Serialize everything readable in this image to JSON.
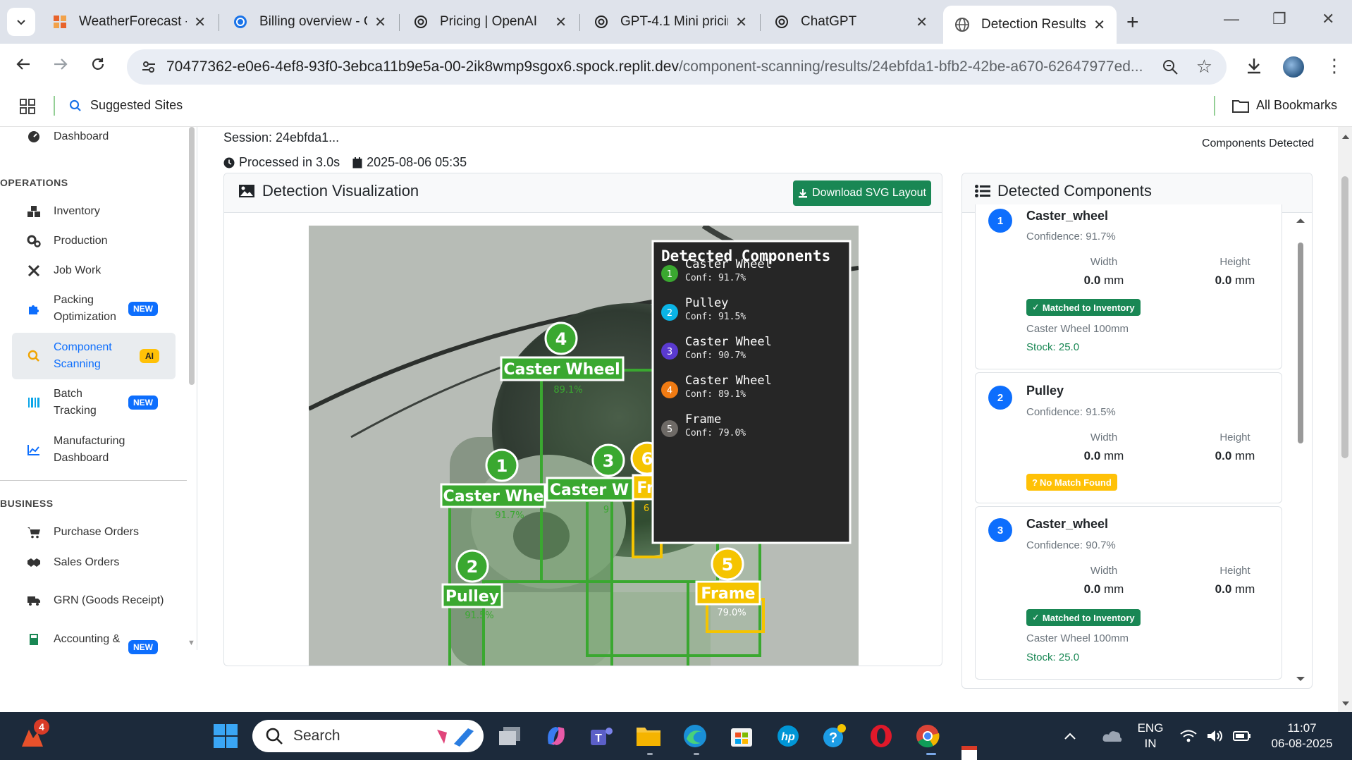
{
  "browser": {
    "tabs": [
      {
        "title": "WeatherForecast -",
        "icon": "weather-app-icon"
      },
      {
        "title": "Billing overview - C",
        "icon": "billing-icon"
      },
      {
        "title": "Pricing | OpenAI",
        "icon": "openai-icon"
      },
      {
        "title": "GPT-4.1 Mini pricir",
        "icon": "openai-icon"
      },
      {
        "title": "ChatGPT",
        "icon": "openai-icon"
      },
      {
        "title": "Detection Results -",
        "icon": "globe-icon",
        "active": true
      }
    ],
    "url_host": "70477362-e0e6-4ef8-93f0-3ebca11b9e5a-00-2ik8wmp9sgox6.spock.replit.dev",
    "url_path": "/component-scanning/results/24ebfda1-bfb2-42be-a670-62647977ed...",
    "bookmarks": {
      "suggested": "Suggested Sites",
      "all": "All Bookmarks"
    }
  },
  "sidebar": {
    "dashboard": "Dashboard",
    "sections": {
      "operations": "OPERATIONS",
      "business": "BUSINESS"
    },
    "items": [
      {
        "label": "Inventory"
      },
      {
        "label": "Production"
      },
      {
        "label": "Job Work"
      },
      {
        "label": "Packing Optimization",
        "badge": "NEW"
      },
      {
        "label": "Component Scanning",
        "badge": "AI",
        "active": true
      },
      {
        "label": "Batch Tracking",
        "badge": "NEW"
      },
      {
        "label": "Manufacturing Dashboard"
      },
      {
        "label": "Purchase Orders"
      },
      {
        "label": "Sales Orders"
      },
      {
        "label": "GRN (Goods Receipt)"
      },
      {
        "label": "Accounting &",
        "badge": "NEW"
      }
    ]
  },
  "main": {
    "session": "Session: 24ebfda1...",
    "processed": "Processed in 3.0s",
    "date": "2025-08-06 05:35",
    "components_detected_label": "Components Detected",
    "viz_title": "Detection Visualization",
    "download_label": "Download SVG Layout",
    "overlay": {
      "title": "Detected Components",
      "items": [
        {
          "n": "1",
          "name": "Caster Wheel",
          "conf": "Conf: 91.7%",
          "color": "#3aa830"
        },
        {
          "n": "2",
          "name": "Pulley",
          "conf": "Conf: 91.5%",
          "color": "#0ab4e6"
        },
        {
          "n": "3",
          "name": "Caster Wheel",
          "conf": "Conf: 90.7%",
          "color": "#5a3ad0"
        },
        {
          "n": "4",
          "name": "Caster Wheel",
          "conf": "Conf: 89.1%",
          "color": "#f07b13"
        },
        {
          "n": "5",
          "name": "Frame",
          "conf": "Conf: 79.0%",
          "color": "#6e6a66"
        }
      ]
    },
    "boxes": {
      "b1": {
        "n": "1",
        "label": "Caster Whe",
        "pct": "91.7%"
      },
      "b2": {
        "n": "2",
        "label": "Pulley",
        "pct": "91.5%"
      },
      "b3": {
        "n": "3",
        "label": "Caster W",
        "pct": "9"
      },
      "b4": {
        "n": "4",
        "label": "Caster Wheel",
        "pct": "89.1%"
      },
      "b5": {
        "n": "5",
        "label": "Frame",
        "pct": "79.0%"
      },
      "b6": {
        "n": "6",
        "label": "Fra",
        "pct": "6"
      }
    }
  },
  "list": {
    "title": "Detected Components",
    "width_label": "Width",
    "height_label": "Height",
    "items": [
      {
        "n": "1",
        "name": "Caster_wheel",
        "conf": "Confidence: 91.7%",
        "width": "0.0",
        "height": "0.0",
        "unit": "mm",
        "status": "Matched to Inventory",
        "match": "Caster Wheel 100mm",
        "stock": "Stock: 25.0"
      },
      {
        "n": "2",
        "name": "Pulley",
        "conf": "Confidence: 91.5%",
        "width": "0.0",
        "height": "0.0",
        "unit": "mm",
        "status": "No Match Found"
      },
      {
        "n": "3",
        "name": "Caster_wheel",
        "conf": "Confidence: 90.7%",
        "width": "0.0",
        "height": "0.0",
        "unit": "mm",
        "status": "Matched to Inventory",
        "match": "Caster Wheel 100mm",
        "stock": "Stock: 25.0"
      }
    ]
  },
  "taskbar": {
    "notification_count": "4",
    "search_placeholder": "Search",
    "lang": "ENG",
    "region": "IN",
    "time": "11:07",
    "date": "06-08-2025"
  }
}
